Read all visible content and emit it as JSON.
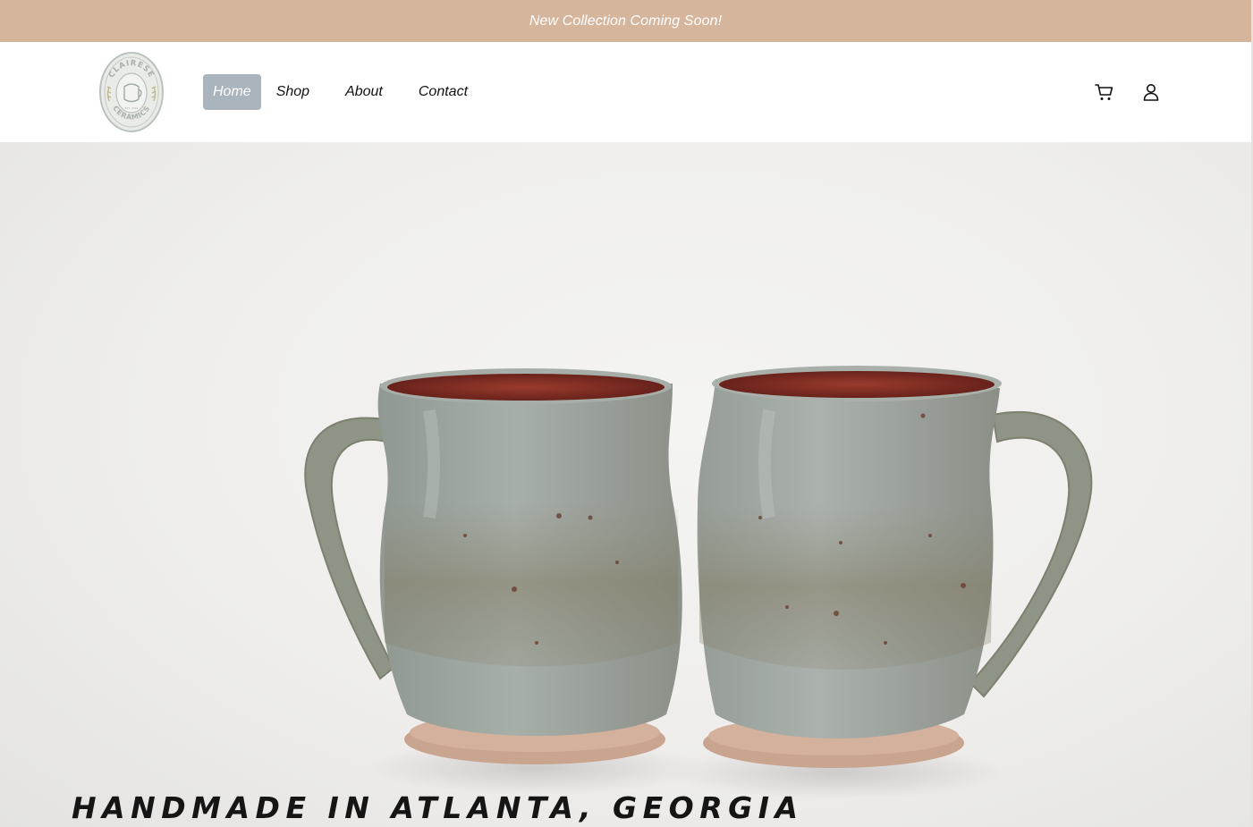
{
  "announcement": {
    "text": "New Collection Coming Soon!"
  },
  "brand": {
    "name_top": "CLAIRESE",
    "name_bottom": "CERAMICS",
    "est": "EST. 2022"
  },
  "nav": {
    "items": [
      {
        "label": "Home",
        "active": true
      },
      {
        "label": "Shop",
        "active": false
      },
      {
        "label": "About",
        "active": false
      },
      {
        "label": "Contact",
        "active": false
      }
    ]
  },
  "header_icons": [
    "cart-icon",
    "account-icon"
  ],
  "hero": {
    "tagline": "HANDMADE IN ATLANTA, GEORGIA"
  },
  "colors": {
    "announcement_bg": "#d6b59d",
    "nav_active_bg": "#a9b4bd",
    "mug_glaze": "#9aa39c",
    "mug_interior": "#7a2a22",
    "clay_base": "#c9a48f"
  }
}
